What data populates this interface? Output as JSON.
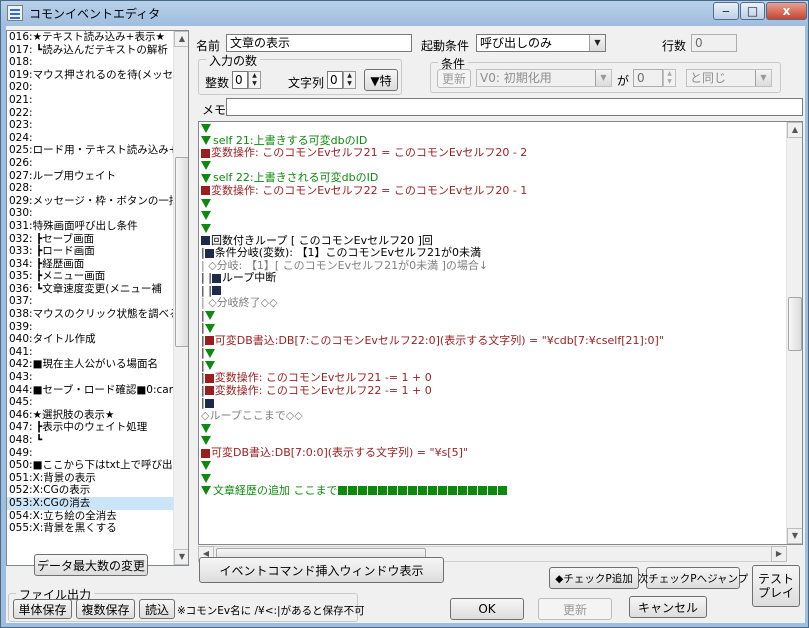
{
  "window": {
    "title": "コモンイベントエディタ",
    "min": "‒",
    "max": "□",
    "close": "x"
  },
  "left_list": [
    {
      "text": "016:★テキスト読み込み+表示★",
      "selected": false
    },
    {
      "text": "017: ┗読み込んだテキストの解析",
      "selected": false
    },
    {
      "text": "018:",
      "selected": false
    },
    {
      "text": "019:マウス押されるのを待(メッセー",
      "selected": false
    },
    {
      "text": "020:",
      "selected": false
    },
    {
      "text": "021:",
      "selected": false
    },
    {
      "text": "022:",
      "selected": false
    },
    {
      "text": "023:",
      "selected": false
    },
    {
      "text": "024:",
      "selected": false
    },
    {
      "text": "025:ロード用・テキスト読み込み+表",
      "selected": false
    },
    {
      "text": "026:",
      "selected": false
    },
    {
      "text": "027:ループ用ウェイト",
      "selected": false
    },
    {
      "text": "028:",
      "selected": false
    },
    {
      "text": "029:メッセージ・枠・ボタンの一括削",
      "selected": false
    },
    {
      "text": "030:",
      "selected": false
    },
    {
      "text": "031:特殊画面呼び出し条件",
      "selected": false
    },
    {
      "text": "032: ┣セーブ画面",
      "selected": false
    },
    {
      "text": "033: ┣ロード画面",
      "selected": false
    },
    {
      "text": "034: ┣経歴画面",
      "selected": false
    },
    {
      "text": "035: ┣メニュー画面",
      "selected": false
    },
    {
      "text": "036: ┗文章速度変更(メニュー補",
      "selected": false
    },
    {
      "text": "037:",
      "selected": false
    },
    {
      "text": "038:マウスのクリック状態を調べる",
      "selected": false
    },
    {
      "text": "039:",
      "selected": false
    },
    {
      "text": "040:タイトル作成",
      "selected": false
    },
    {
      "text": "041:",
      "selected": false
    },
    {
      "text": "042:■現在主人公がいる場面名",
      "selected": false
    },
    {
      "text": "043:",
      "selected": false
    },
    {
      "text": "044:■セーブ・ロード確認■0:can",
      "selected": false
    },
    {
      "text": "045:",
      "selected": false
    },
    {
      "text": "046:★選択肢の表示★",
      "selected": false
    },
    {
      "text": "047: ┣表示中のウェイト処理",
      "selected": false
    },
    {
      "text": "048: ┗",
      "selected": false
    },
    {
      "text": "049:",
      "selected": false
    },
    {
      "text": "050:■ここから下はtxt上で呼び出",
      "selected": false
    },
    {
      "text": "051:X:背景の表示",
      "selected": false
    },
    {
      "text": "052:X:CGの表示",
      "selected": false
    },
    {
      "text": "053:X:CGの消去",
      "selected": true
    },
    {
      "text": "054:X:立ち絵の全消去",
      "selected": false
    },
    {
      "text": "055:X:背景を黒くする",
      "selected": false
    }
  ],
  "form": {
    "name_label": "名前",
    "name_value": "文章の表示",
    "trigger_label": "起動条件",
    "trigger_value": "呼び出しのみ",
    "lines_label": "行数",
    "lines_value": "0",
    "input_group_title": "入力の数",
    "int_label": "整数",
    "int_value": "0",
    "str_label": "文字列",
    "str_value": "0",
    "special_button": "▼特",
    "condition_group_title": "条件",
    "update_button": "更新",
    "cond_var": "V0: 初期化用",
    "ga_label": "が",
    "cond_num": "0",
    "cond_op": "と同じ",
    "memo_label": "メモ",
    "memo_value": ""
  },
  "event_lines": [
    {
      "indent": 0,
      "parts": [
        {
          "t": "tri"
        }
      ]
    },
    {
      "indent": 0,
      "parts": [
        {
          "t": "tri"
        },
        {
          "t": "text",
          "c": "gr",
          "v": "self 21:上書きする可変dbのID"
        }
      ]
    },
    {
      "indent": 0,
      "parts": [
        {
          "t": "sq",
          "c": "r"
        },
        {
          "t": "text",
          "c": "dr",
          "v": "変数操作: このコモンEvセルフ21 = このコモンEvセルフ20 - 2"
        }
      ]
    },
    {
      "indent": 0,
      "parts": [
        {
          "t": "tri"
        }
      ]
    },
    {
      "indent": 0,
      "parts": [
        {
          "t": "tri"
        },
        {
          "t": "text",
          "c": "gr",
          "v": "self 22:上書きされる可変dbのID"
        }
      ]
    },
    {
      "indent": 0,
      "parts": [
        {
          "t": "sq",
          "c": "r"
        },
        {
          "t": "text",
          "c": "dr",
          "v": "変数操作: このコモンEvセルフ22 = このコモンEvセルフ20 - 1"
        }
      ]
    },
    {
      "indent": 0,
      "parts": [
        {
          "t": "tri"
        }
      ]
    },
    {
      "indent": 0,
      "parts": [
        {
          "t": "tri"
        }
      ]
    },
    {
      "indent": 0,
      "parts": [
        {
          "t": "tri"
        }
      ]
    },
    {
      "indent": 0,
      "parts": [
        {
          "t": "sq",
          "c": "k"
        },
        {
          "t": "text",
          "c": "bk",
          "v": "回数付きループ [ このコモンEvセルフ20 ]回"
        }
      ]
    },
    {
      "indent": 0,
      "parts": [
        {
          "t": "text",
          "c": "bk",
          "v": " |"
        },
        {
          "t": "sq",
          "c": "k"
        },
        {
          "t": "text",
          "c": "bk",
          "v": "条件分岐(変数): 【1】このコモンEvセルフ21が0未満"
        }
      ]
    },
    {
      "indent": 0,
      "parts": [
        {
          "t": "text",
          "c": "gy",
          "v": " |  ◇分岐: 【1】[ このコモンEvセルフ21が0未満 ]の場合↓"
        }
      ]
    },
    {
      "indent": 0,
      "parts": [
        {
          "t": "text",
          "c": "bk",
          "v": " |  |"
        },
        {
          "t": "sq",
          "c": "k"
        },
        {
          "t": "text",
          "c": "bk",
          "v": "ループ中断"
        }
      ]
    },
    {
      "indent": 0,
      "parts": [
        {
          "t": "text",
          "c": "bk",
          "v": " |  |"
        },
        {
          "t": "sq",
          "c": "k"
        }
      ]
    },
    {
      "indent": 0,
      "parts": [
        {
          "t": "text",
          "c": "gy",
          "v": " |  ◇分岐終了◇◇"
        }
      ]
    },
    {
      "indent": 0,
      "parts": [
        {
          "t": "text",
          "c": "bk",
          "v": " |"
        },
        {
          "t": "tri"
        }
      ]
    },
    {
      "indent": 0,
      "parts": [
        {
          "t": "text",
          "c": "bk",
          "v": " |"
        },
        {
          "t": "tri"
        }
      ]
    },
    {
      "indent": 0,
      "parts": [
        {
          "t": "text",
          "c": "bk",
          "v": " |"
        },
        {
          "t": "sq",
          "c": "r"
        },
        {
          "t": "text",
          "c": "dr",
          "v": "可変DB書込:DB[7:このコモンEvセルフ22:0](表示する文字列) = \"¥cdb[7:¥cself[21]:0]\""
        }
      ]
    },
    {
      "indent": 0,
      "parts": [
        {
          "t": "text",
          "c": "bk",
          "v": " |"
        },
        {
          "t": "tri"
        }
      ]
    },
    {
      "indent": 0,
      "parts": [
        {
          "t": "text",
          "c": "bk",
          "v": " |"
        },
        {
          "t": "tri"
        }
      ]
    },
    {
      "indent": 0,
      "parts": [
        {
          "t": "text",
          "c": "bk",
          "v": " |"
        },
        {
          "t": "sq",
          "c": "r"
        },
        {
          "t": "text",
          "c": "dr",
          "v": "変数操作: このコモンEvセルフ21 -= 1 + 0"
        }
      ]
    },
    {
      "indent": 0,
      "parts": [
        {
          "t": "text",
          "c": "bk",
          "v": " |"
        },
        {
          "t": "sq",
          "c": "r"
        },
        {
          "t": "text",
          "c": "dr",
          "v": "変数操作: このコモンEvセルフ22 -= 1 + 0"
        }
      ]
    },
    {
      "indent": 0,
      "parts": [
        {
          "t": "text",
          "c": "bk",
          "v": " |"
        },
        {
          "t": "sq",
          "c": "k"
        }
      ]
    },
    {
      "indent": 0,
      "parts": [
        {
          "t": "text",
          "c": "gy",
          "v": "◇ループここまで◇◇"
        }
      ]
    },
    {
      "indent": 0,
      "parts": [
        {
          "t": "tri"
        }
      ]
    },
    {
      "indent": 0,
      "parts": [
        {
          "t": "tri"
        }
      ]
    },
    {
      "indent": 0,
      "parts": [
        {
          "t": "sq",
          "c": "r"
        },
        {
          "t": "text",
          "c": "dr",
          "v": "可変DB書込:DB[7:0:0](表示する文字列) = \"¥s[5]\""
        }
      ]
    },
    {
      "indent": 0,
      "parts": [
        {
          "t": "tri"
        }
      ]
    },
    {
      "indent": 0,
      "parts": [
        {
          "t": "tri"
        }
      ]
    },
    {
      "indent": 0,
      "parts": [
        {
          "t": "tri"
        },
        {
          "t": "text",
          "c": "gr",
          "v": "文章経歴の追加  ここまで"
        },
        {
          "t": "sqrow",
          "n": 17
        }
      ]
    }
  ],
  "buttons": {
    "max_data": "データ最大数の変更",
    "insert_window": "イベントコマンド挿入ウィンドウ表示",
    "check_add": "◆チェックP追加",
    "check_jump": "次チェックPへジャンプ",
    "test_play_1": "テスト",
    "test_play_2": "プレイ",
    "file_group_title": "ファイル出力",
    "single_save": "単体保存",
    "multi_save": "複数保存",
    "load": "読込",
    "note": "※コモンEv名に /¥<:|があると保存不可",
    "ok": "OK",
    "update": "更新",
    "cancel": "キャンセル"
  },
  "colors": {
    "comment_green": "#0d8a0d",
    "command_red": "#9a1e1e",
    "selected_row": "#cce4f7"
  }
}
